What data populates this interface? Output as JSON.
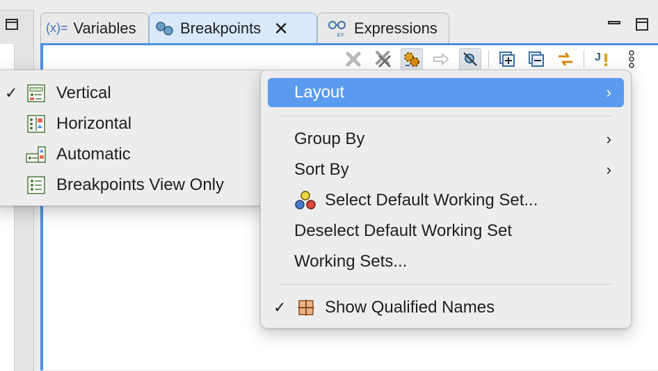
{
  "tabs": [
    {
      "label": "Variables",
      "icon": "variables-icon",
      "prefix": "(x)="
    },
    {
      "label": "Breakpoints",
      "icon": "breakpoints-icon",
      "close": "✕"
    },
    {
      "label": "Expressions",
      "icon": "expressions-icon"
    }
  ],
  "toolbar": {
    "icons": [
      "remove-icon",
      "remove-all-icon",
      "link-with-debug-view-icon",
      "go-to-file-icon",
      "skip-all-breakpoints-icon",
      "expand-all-icon",
      "collapse-all-icon",
      "link-icon",
      "java-exception-breakpoint-icon",
      "view-menu-icon"
    ]
  },
  "layout_submenu": {
    "items": [
      {
        "label": "Vertical",
        "checked": true,
        "check_glyph": "✓",
        "icon": "vertical-layout-icon"
      },
      {
        "label": "Horizontal",
        "checked": false,
        "icon": "horizontal-layout-icon"
      },
      {
        "label": "Automatic",
        "checked": false,
        "icon": "automatic-layout-icon"
      },
      {
        "label": "Breakpoints View Only",
        "checked": false,
        "icon": "breakpoints-view-only-icon"
      }
    ]
  },
  "view_menu": {
    "layout": {
      "label": "Layout",
      "arrow": "›"
    },
    "group_by": {
      "label": "Group By",
      "arrow": "›"
    },
    "sort_by": {
      "label": "Sort By",
      "arrow": "›"
    },
    "select_default_ws": {
      "label": "Select Default Working Set...",
      "icon": "working-set-icon"
    },
    "deselect_default_ws": {
      "label": "Deselect Default Working Set"
    },
    "working_sets": {
      "label": "Working Sets..."
    },
    "show_qualified": {
      "label": "Show Qualified Names",
      "checked": true,
      "check_glyph": "✓",
      "icon": "qualified-names-icon"
    }
  },
  "colors": {
    "accent": "#4a90e2",
    "menu_highlight": "#5a9bf0"
  }
}
